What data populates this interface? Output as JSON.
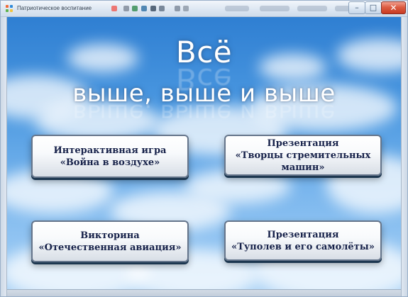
{
  "window": {
    "title": "Патриотическое воспитание",
    "close_glyph": "✕",
    "minimize_glyph": "–",
    "maximize_glyph": "□"
  },
  "slide": {
    "headline_line1": "Всё",
    "headline_line2": "выше, выше и выше"
  },
  "buttons": [
    {
      "label": "Интерактивная игра\n«Война в воздухе»"
    },
    {
      "label": "Презентация\n«Творцы стремительных\nмашин»"
    },
    {
      "label": "Викторина\n«Отечественная авиация»"
    },
    {
      "label": "Презентация\n«Туполев и его самолёты»"
    }
  ],
  "icons": {
    "app": "presentation-app-icon",
    "minimize": "minimize-icon",
    "maximize": "maximize-icon",
    "close": "close-icon"
  },
  "colors": {
    "sky_top": "#2f7fd2",
    "sky_bottom": "#a7d1f6",
    "button_text": "#17224a",
    "close_button": "#d9533a"
  }
}
